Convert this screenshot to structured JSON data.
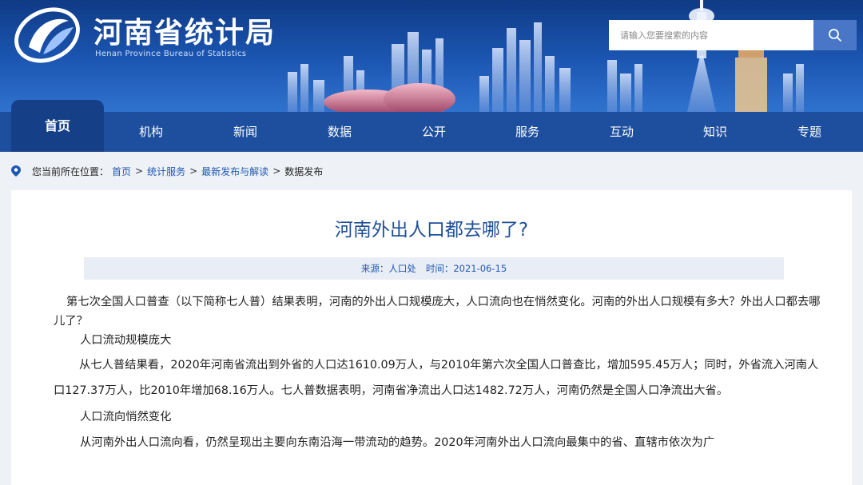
{
  "header": {
    "title": "河南省统计局",
    "subtitle": "Henan Province Bureau of Statistics",
    "search_placeholder": "请输入您要搜索的内容"
  },
  "nav": {
    "items": [
      "首页",
      "机构",
      "新闻",
      "数据",
      "公开",
      "服务",
      "互动",
      "知识",
      "专题"
    ],
    "active": "首页"
  },
  "breadcrumb": {
    "prefix": "您当前所在位置：",
    "links": [
      "首页",
      "统计服务",
      "最新发布与解读"
    ],
    "current": "数据发布",
    "separator": ">"
  },
  "article": {
    "title": "河南外出人口都去哪了?",
    "source": "来源：人口处",
    "time": "时间：2021-06-15",
    "paragraphs": [
      "第七次全国人口普查（以下简称七人普）结果表明，河南的外出人口规模庞大，人口流向也在悄然变化。河南的外出人口规模有多大？外出人口都去哪儿了？",
      "人口流动规模庞大",
      "从七人普结果看，2020年河南省流出到外省的人口达1610.09万人，与2010年第六次全国人口普查比，增加595.45万人；同时，外省流入河南人口127.37万人，比2010年增加68.16万人。七人普数据表明，河南省净流出人口达1482.72万人，河南仍然是全国人口净流出大省。",
      "人口流向悄然变化",
      "从河南外出人口流向看，仍然呈现出主要向东南沿海一带流动的趋势。2020年河南外出人口流向最集中的省、直辖市依次为广"
    ]
  },
  "colors": {
    "header_bg": "#1c57b3",
    "nav_bg": "#1e4f9e",
    "nav_active_bg": "#153f86",
    "title_color": "#1f4f98",
    "link_color": "#1f57b3",
    "meta_bg": "#e9eef6"
  },
  "icons": {
    "logo": "henan-stats-logo-icon",
    "search": "search-icon",
    "location": "location-pin-icon"
  }
}
